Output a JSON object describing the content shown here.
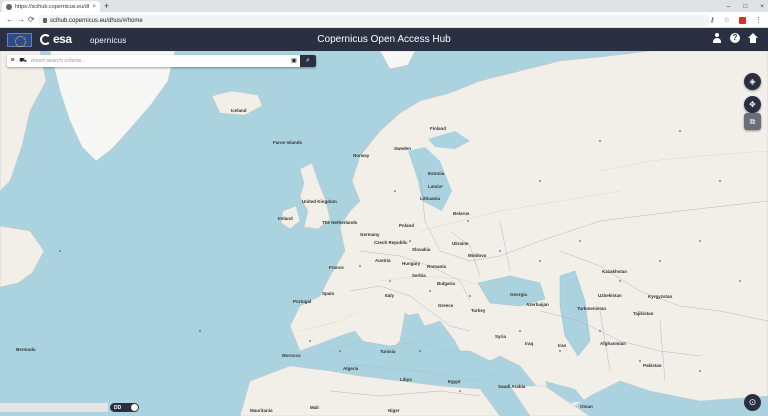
{
  "browser": {
    "tab_title": "https://scihub.copernicus.eu/dh...",
    "tab_close": "×",
    "new_tab": "+",
    "url": "scihub.copernicus.eu/dhus/#/home",
    "nav": {
      "back": "←",
      "forward": "→",
      "reload": "⟳"
    },
    "window": {
      "minimize": "–",
      "maximize": "□",
      "close": "×"
    },
    "actions": {
      "key": "⚷",
      "star": "☆",
      "menu": "⋮"
    }
  },
  "header": {
    "title": "Copernicus Open Access Hub",
    "esa_logo": "esa",
    "copernicus_logo": "opernicus",
    "help": "?"
  },
  "search": {
    "menu_glyph": "≡",
    "cart_glyph": "⛟",
    "placeholder": "Insert search criteria...",
    "save_glyph": "▣",
    "search_glyph": "⌕"
  },
  "tools": {
    "layers": "◈",
    "move": "✥",
    "select": "⧉",
    "locate": "⊙"
  },
  "bottom": {
    "toggle_label": "DD"
  },
  "map_labels": [
    {
      "text": "Iceland"
    },
    {
      "text": "Faroe Islands"
    },
    {
      "text": "Norway"
    },
    {
      "text": "Sweden"
    },
    {
      "text": "Finland"
    },
    {
      "text": "Estonia"
    },
    {
      "text": "Latvia"
    },
    {
      "text": "Lithuania"
    },
    {
      "text": "Belarus"
    },
    {
      "text": "Ireland"
    },
    {
      "text": "United Kingdom"
    },
    {
      "text": "The Netherlands"
    },
    {
      "text": "Germany"
    },
    {
      "text": "Poland"
    },
    {
      "text": "Czech Republic"
    },
    {
      "text": "Slovakia"
    },
    {
      "text": "Ukraine"
    },
    {
      "text": "Moldova"
    },
    {
      "text": "France"
    },
    {
      "text": "Austria"
    },
    {
      "text": "Hungary"
    },
    {
      "text": "Romania"
    },
    {
      "text": "Serbia"
    },
    {
      "text": "Bulgaria"
    },
    {
      "text": "Italy"
    },
    {
      "text": "Spain"
    },
    {
      "text": "Portugal"
    },
    {
      "text": "Greece"
    },
    {
      "text": "Turkey"
    },
    {
      "text": "Georgia"
    },
    {
      "text": "Azerbaijan"
    },
    {
      "text": "Kazakhstan"
    },
    {
      "text": "Uzbekistan"
    },
    {
      "text": "Turkmenistan"
    },
    {
      "text": "Kyrgyzstan"
    },
    {
      "text": "Tajikistan"
    },
    {
      "text": "Afghanistan"
    },
    {
      "text": "Iran"
    },
    {
      "text": "Iraq"
    },
    {
      "text": "Syria"
    },
    {
      "text": "Morocco"
    },
    {
      "text": "Algeria"
    },
    {
      "text": "Tunisia"
    },
    {
      "text": "Libya"
    },
    {
      "text": "Egypt"
    },
    {
      "text": "Saudi Arabia"
    },
    {
      "text": "Pakistan"
    },
    {
      "text": "Oman"
    },
    {
      "text": "Mauritania"
    },
    {
      "text": "Mali"
    },
    {
      "text": "Niger"
    },
    {
      "text": "Bermuda"
    }
  ],
  "colors": {
    "header": "#2b2f42",
    "sea": "#aad3df",
    "land": "#f2efe9",
    "ice": "#ffffff"
  }
}
